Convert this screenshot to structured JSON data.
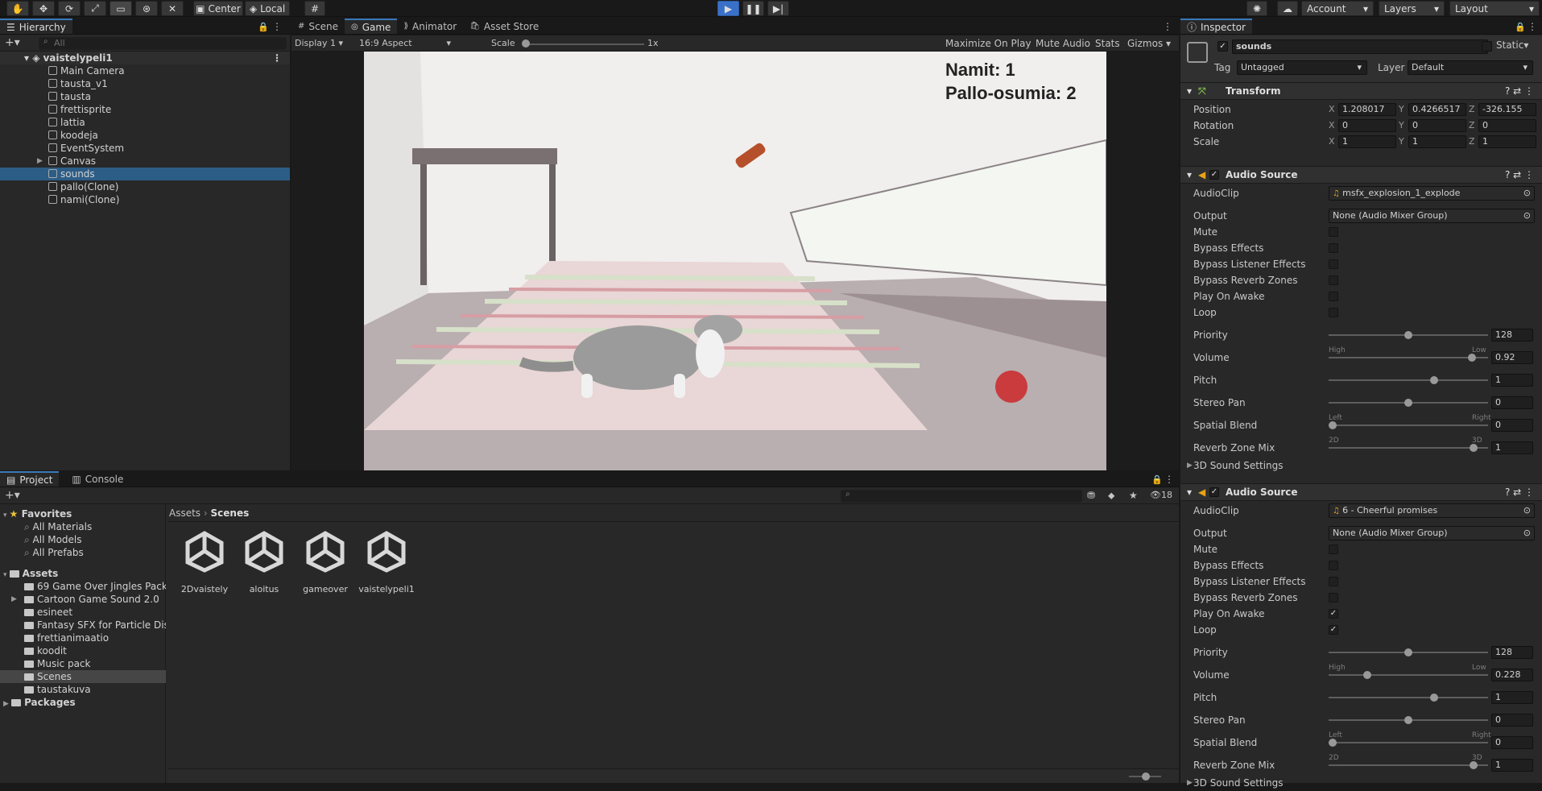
{
  "toolbar": {
    "center_label": "Center",
    "local_label": "Local",
    "account_label": "Account",
    "layers_label": "Layers",
    "layout_label": "Layout"
  },
  "hierarchy": {
    "tab": "Hierarchy",
    "search_placeholder": "All",
    "scene": "vaistelypeli1",
    "items": [
      "Main Camera",
      "tausta_v1",
      "tausta",
      "frettisprite",
      "lattia",
      "koodeja",
      "EventSystem",
      "Canvas",
      "sounds",
      "pallo(Clone)",
      "nami(Clone)"
    ],
    "selected": "sounds"
  },
  "center_tabs": [
    "Scene",
    "Game",
    "Animator",
    "Asset Store"
  ],
  "game_bar": {
    "display": "Display 1",
    "aspect": "16:9 Aspect",
    "scale_label": "Scale",
    "scale_value": "1x",
    "maximize": "Maximize On Play",
    "mute": "Mute Audio",
    "stats": "Stats",
    "gizmos": "Gizmos"
  },
  "game_view": {
    "namit": "Namit: 1",
    "pallo": "Pallo-osumia: 2"
  },
  "inspector": {
    "tab": "Inspector",
    "object_name": "sounds",
    "static_label": "Static",
    "tag_label": "Tag",
    "tag_value": "Untagged",
    "layer_label": "Layer",
    "layer_value": "Default",
    "transform": {
      "title": "Transform",
      "position_label": "Position",
      "rotation_label": "Rotation",
      "scale_label": "Scale",
      "position": [
        "1.208017",
        "0.4266517",
        "-326.155"
      ],
      "rotation": [
        "0",
        "0",
        "0"
      ],
      "scale": [
        "1",
        "1",
        "1"
      ]
    },
    "audio_sources": [
      {
        "title": "Audio Source",
        "clip_label": "AudioClip",
        "clip": "msfx_explosion_1_explode",
        "output_label": "Output",
        "output": "None (Audio Mixer Group)",
        "mute": "Mute",
        "bypass_effects": "Bypass Effects",
        "bypass_listener": "Bypass Listener Effects",
        "bypass_reverb": "Bypass Reverb Zones",
        "play_on_awake": "Play On Awake",
        "loop": "Loop",
        "play_on_awake_checked": false,
        "loop_checked": false,
        "priority_label": "Priority",
        "priority": "128",
        "volume_label": "Volume",
        "volume": "0.92",
        "pitch_label": "Pitch",
        "pitch": "1",
        "pan_label": "Stereo Pan",
        "pan": "0",
        "spatial_label": "Spatial Blend",
        "spatial": "0",
        "reverb_label": "Reverb Zone Mix",
        "reverb": "1",
        "high": "High",
        "low": "Low",
        "left": "Left",
        "right": "Right",
        "d2": "2D",
        "d3": "3D",
        "settings3d": "3D Sound Settings"
      },
      {
        "title": "Audio Source",
        "clip_label": "AudioClip",
        "clip": "6 - Cheerful promises",
        "output_label": "Output",
        "output": "None (Audio Mixer Group)",
        "mute": "Mute",
        "bypass_effects": "Bypass Effects",
        "bypass_listener": "Bypass Listener Effects",
        "bypass_reverb": "Bypass Reverb Zones",
        "play_on_awake": "Play On Awake",
        "loop": "Loop",
        "play_on_awake_checked": true,
        "loop_checked": true,
        "priority_label": "Priority",
        "priority": "128",
        "volume_label": "Volume",
        "volume": "0.228",
        "pitch_label": "Pitch",
        "pitch": "1",
        "pan_label": "Stereo Pan",
        "pan": "0",
        "spatial_label": "Spatial Blend",
        "spatial": "0",
        "reverb_label": "Reverb Zone Mix",
        "reverb": "1",
        "high": "High",
        "low": "Low",
        "left": "Left",
        "right": "Right",
        "d2": "2D",
        "d3": "3D",
        "settings3d": "3D Sound Settings"
      }
    ]
  },
  "project": {
    "tabs": [
      "Project",
      "Console"
    ],
    "hidden_count": "18",
    "favorites_label": "Favorites",
    "favorites": [
      "All Materials",
      "All Models",
      "All Prefabs"
    ],
    "assets_label": "Assets",
    "folders": [
      "69 Game Over Jingles Pack",
      "Cartoon Game Sound 2.0",
      "esineet",
      "Fantasy SFX for Particle Dis",
      "frettianimaatio",
      "koodit",
      "Music pack",
      "Scenes",
      "taustakuva"
    ],
    "selected_folder": "Scenes",
    "packages_label": "Packages",
    "breadcrumb": [
      "Assets",
      "Scenes"
    ],
    "scenes": [
      "2Dvaistely",
      "aloitus",
      "gameover",
      "vaistelypeli1"
    ]
  }
}
